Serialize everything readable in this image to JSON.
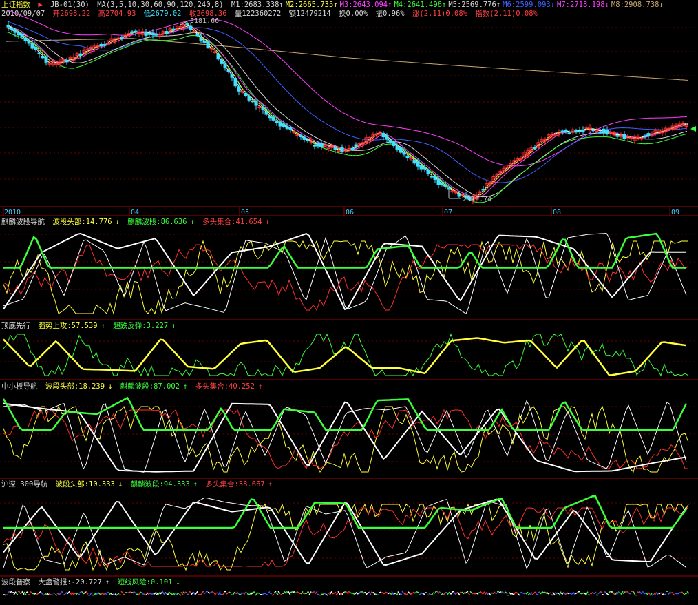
{
  "header": {
    "index_name": "上证指数",
    "formula": "JB-01(30)",
    "ma_params": "MA(3,5,10,30,60,90,120,240,8)",
    "mas": [
      {
        "label": "M1:2683.338",
        "arrow": "↑"
      },
      {
        "label": "M2:2665.735",
        "arrow": "↑"
      },
      {
        "label": "M3:2643.094",
        "arrow": "↑"
      },
      {
        "label": "M4:2641.496",
        "arrow": "↑"
      },
      {
        "label": "M5:2569.776",
        "arrow": "↑"
      },
      {
        "label": "M6:2599.093",
        "arrow": "↓"
      },
      {
        "label": "M7:2718.198",
        "arrow": "↓"
      },
      {
        "label": "M8:2908.738",
        "arrow": "↓"
      }
    ],
    "date": "2010/09/07",
    "open": "开2698.22",
    "high": "高2704.93",
    "low": "低2679.02",
    "close": "收2698.36",
    "volume": "量122360272",
    "amount": "额12479214",
    "turnover": "换0.00%",
    "amplitude": "振0.96%",
    "change": "涨(2.11)0.08%",
    "index_change": "指数(2.11)0.08%"
  },
  "colors": {
    "m1": "#ffffff",
    "m2": "#ffff3c",
    "m3": "#ff40ff",
    "m4": "#3cff3c",
    "m5": "#d8d8d8",
    "m6": "#4060ff",
    "m7": "#ff40ff",
    "m8": "#c8a870",
    "up": "#ff3030",
    "down": "#40e0ff",
    "grid": "#a00000"
  },
  "time_axis": [
    "2010",
    "04",
    "05",
    "06",
    "07",
    "08",
    "09"
  ],
  "annotations": {
    "high": "3181.66",
    "low": "2319.74"
  },
  "panels": [
    {
      "name": "麒麟波段导航",
      "items": [
        {
          "text": "波段头部:14.776",
          "arrow": "↓",
          "color": "y"
        },
        {
          "text": "麒麟波段:86.636",
          "arrow": "↑",
          "color": "g"
        },
        {
          "text": "多头集合:41.654",
          "arrow": "↑",
          "color": "r"
        }
      ]
    },
    {
      "name": "顶底先行",
      "items": [
        {
          "text": "强势上攻:57.539",
          "arrow": "↑",
          "color": "y"
        },
        {
          "text": "超跌反弹:3.227",
          "arrow": "↑",
          "color": "g"
        }
      ]
    },
    {
      "name": "中小板导航",
      "items": [
        {
          "text": "波段头部:18.239",
          "arrow": "↓",
          "color": "y"
        },
        {
          "text": "麒麟波段:87.002",
          "arrow": "↑",
          "color": "g"
        },
        {
          "text": "多头集合:40.252",
          "arrow": "↑",
          "color": "r"
        }
      ]
    },
    {
      "name": "沪深 300导航",
      "items": [
        {
          "text": "波段头部:10.333",
          "arrow": "↓",
          "color": "y"
        },
        {
          "text": "麒麟波段:94.333",
          "arrow": "↑",
          "color": "g"
        },
        {
          "text": "多头集合:38.667",
          "arrow": "↑",
          "color": "r"
        }
      ]
    },
    {
      "name": "波段普察",
      "items": [
        {
          "text": "大盘警报:-20.727",
          "arrow": "↑",
          "color": "w"
        },
        {
          "text": "短线风险:0.101",
          "arrow": "↓",
          "color": "g"
        }
      ]
    }
  ],
  "chart_data": {
    "type": "line",
    "title": "上证指数",
    "price_path": [
      [
        "2010-01",
        3180
      ],
      [
        "2010-01",
        3100
      ],
      [
        "2010-02",
        2990
      ],
      [
        "2010-02",
        3010
      ],
      [
        "2010-03",
        3060
      ],
      [
        "2010-03",
        3100
      ],
      [
        "2010-04",
        3150
      ],
      [
        "2010-04",
        3130
      ],
      [
        "2010-04",
        3181.66
      ],
      [
        "2010-04",
        3050
      ],
      [
        "2010-05",
        2850
      ],
      [
        "2010-05",
        2700
      ],
      [
        "2010-05",
        2600
      ],
      [
        "2010-06",
        2560
      ],
      [
        "2010-06",
        2650
      ],
      [
        "2010-06",
        2520
      ],
      [
        "2010-07",
        2380
      ],
      [
        "2010-07",
        2319.74
      ],
      [
        "2010-07",
        2450
      ],
      [
        "2010-07",
        2550
      ],
      [
        "2010-08",
        2650
      ],
      [
        "2010-08",
        2670
      ],
      [
        "2010-08",
        2620
      ],
      [
        "2010-09",
        2698.36
      ]
    ],
    "ma8_path": [
      [
        "2010-01",
        3100
      ],
      [
        "2010-04",
        3115
      ],
      [
        "2010-05",
        3070
      ],
      [
        "2010-06",
        3020
      ],
      [
        "2010-07",
        2985
      ],
      [
        "2010-08",
        2950
      ],
      [
        "2010-09",
        2908.738
      ]
    ],
    "price_labels": {
      "high": "3181.66",
      "low": "2319.74"
    }
  }
}
